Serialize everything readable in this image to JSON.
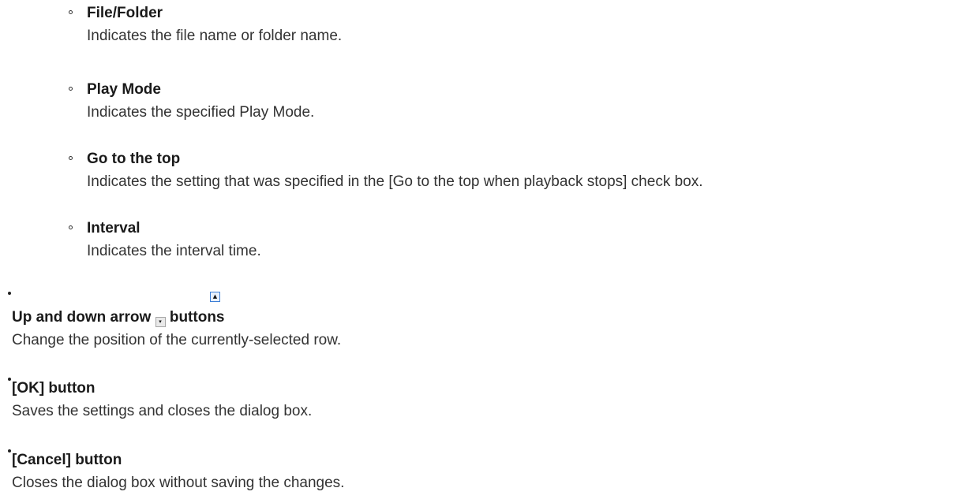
{
  "sub_items": [
    {
      "title": "File/Folder",
      "desc": "Indicates the file name or folder name."
    },
    {
      "title": "Play Mode",
      "desc": "Indicates the specified Play Mode."
    },
    {
      "title": "Go to the top",
      "desc": "Indicates the setting that was specified in the [Go to the top when playback stops] check box."
    },
    {
      "title": "Interval",
      "desc": "Indicates the interval time."
    }
  ],
  "main_items": [
    {
      "title_before": "Up and down arrow",
      "title_after": "buttons",
      "up_icon": "▲",
      "down_icon": "▾",
      "desc": "Change the position of the currently-selected row."
    },
    {
      "title": "[OK] button",
      "desc": "Saves the settings and closes the dialog box."
    },
    {
      "title": "[Cancel] button",
      "desc": "Closes the dialog box without saving the changes."
    }
  ]
}
